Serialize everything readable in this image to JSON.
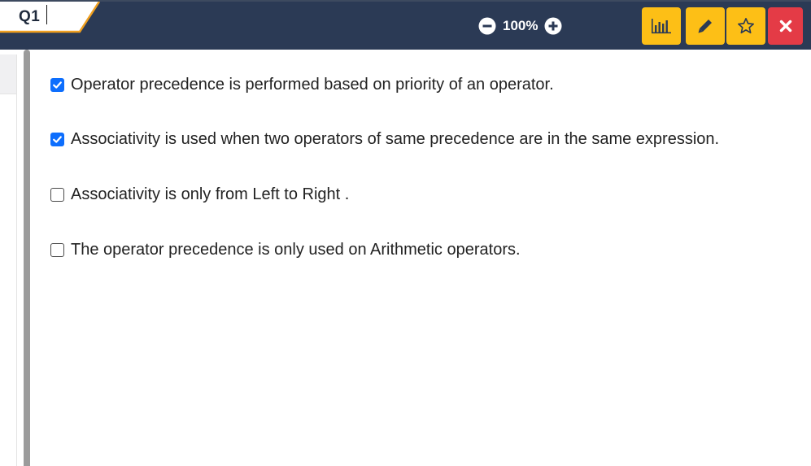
{
  "header": {
    "question_tab": "Q1",
    "zoom": {
      "value": "100%",
      "decrease_icon": "minus-circle-icon",
      "increase_icon": "plus-circle-icon"
    },
    "toolbar": [
      {
        "icon": "bar-chart-icon",
        "color": "#fdbf16"
      },
      {
        "icon": "pencil-icon",
        "color": "#fdbf16"
      },
      {
        "icon": "star-outline-icon",
        "color": "#fdbf16"
      },
      {
        "icon": "close-icon",
        "color": "#e43b46"
      }
    ]
  },
  "question": {
    "options": [
      {
        "text": "Operator precedence is performed based on priority of an operator.",
        "checked": true
      },
      {
        "text": "Associativity is used when two operators of same precedence are in the same expression.",
        "checked": true
      },
      {
        "text": "Associativity is only from Left to Right .",
        "checked": false
      },
      {
        "text": "The operator precedence is only used on Arithmetic operators.",
        "checked": false
      }
    ]
  },
  "colors": {
    "header_bg": "#2b3a55",
    "accent_orange": "#f0a020",
    "checkbox_checked": "#0d6efd"
  }
}
